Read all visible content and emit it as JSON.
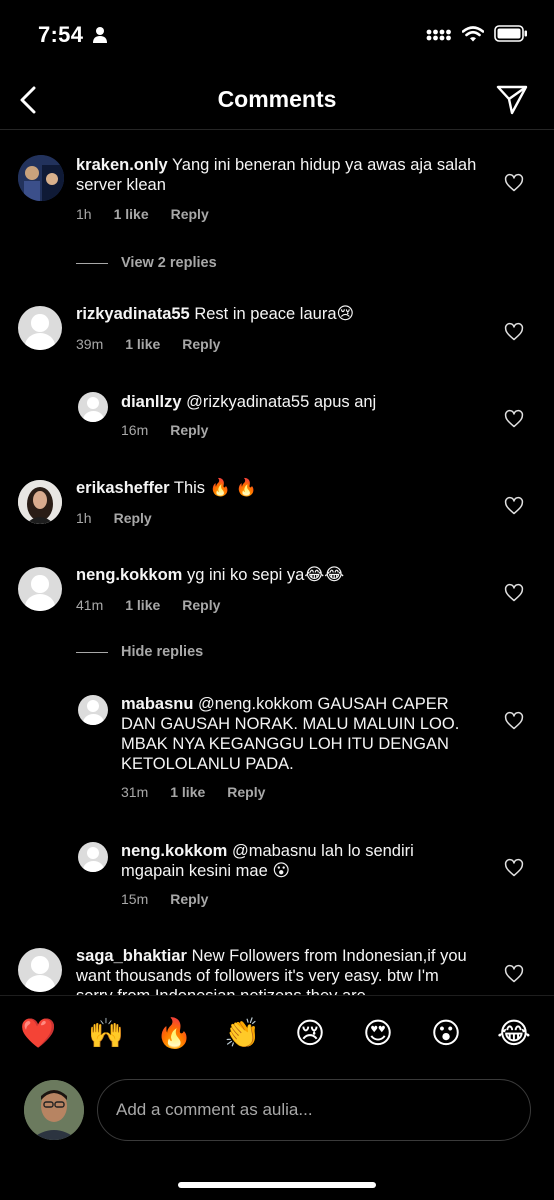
{
  "status_bar": {
    "time": "7:54"
  },
  "header": {
    "title": "Comments"
  },
  "comments": [
    {
      "username": "kraken.only",
      "text": "Yang ini beneran hidup ya awas aja salah server klean",
      "time": "1h",
      "likes": "1 like",
      "reply_label": "Reply"
    },
    {
      "username": "rizkyadinata55",
      "text": "Rest in peace laura",
      "emoji": "😢",
      "time": "39m",
      "likes": "1 like",
      "reply_label": "Reply"
    },
    {
      "username": "dianllzy",
      "text": "@rizkyadinata55 apus anj",
      "time": "16m",
      "reply_label": "Reply"
    },
    {
      "username": "erikasheffer",
      "text": "This",
      "emoji": "🔥 🔥",
      "time": "1h",
      "reply_label": "Reply"
    },
    {
      "username": "neng.kokkom",
      "text": "yg ini ko sepi ya",
      "emoji": "😂😂",
      "time": "41m",
      "likes": "1 like",
      "reply_label": "Reply"
    },
    {
      "username": "mabasnu",
      "text": "@neng.kokkom GAUSAH CAPER DAN GAUSAH NORAK. MALU MALUIN LOO. MBAK NYA KEGANGGU LOH ITU DENGAN KETOLOLANLU PADA.",
      "time": "31m",
      "likes": "1 like",
      "reply_label": "Reply"
    },
    {
      "username": "neng.kokkom",
      "text": "@mabasnu lah lo sendiri mgapain kesini mae",
      "emoji": "😮",
      "time": "15m",
      "reply_label": "Reply"
    },
    {
      "username": "saga_bhaktiar",
      "text": "New Followers from Indonesian,if you want thousands of followers it's very easy. btw I'm sorry from Indonesian netizens they are"
    }
  ],
  "replies_toggles": {
    "view": "View 2 replies",
    "hide": "Hide replies"
  },
  "emoji_bar": [
    "❤️",
    "🙌",
    "🔥",
    "👏",
    "😢",
    "😍",
    "😮",
    "😂"
  ],
  "input": {
    "placeholder": "Add a comment as aulia..."
  }
}
